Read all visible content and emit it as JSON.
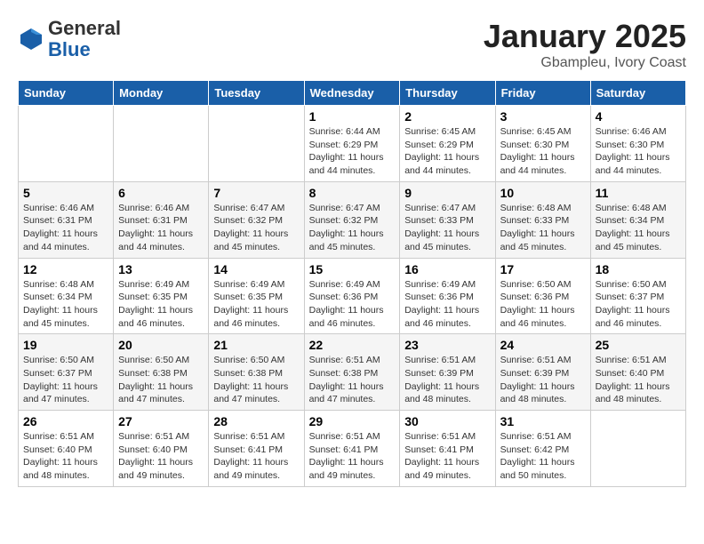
{
  "header": {
    "logo_line1": "General",
    "logo_line2": "Blue",
    "month_title": "January 2025",
    "location": "Gbampleu, Ivory Coast"
  },
  "weekdays": [
    "Sunday",
    "Monday",
    "Tuesday",
    "Wednesday",
    "Thursday",
    "Friday",
    "Saturday"
  ],
  "weeks": [
    [
      {
        "day": "",
        "info": ""
      },
      {
        "day": "",
        "info": ""
      },
      {
        "day": "",
        "info": ""
      },
      {
        "day": "1",
        "info": "Sunrise: 6:44 AM\nSunset: 6:29 PM\nDaylight: 11 hours\nand 44 minutes."
      },
      {
        "day": "2",
        "info": "Sunrise: 6:45 AM\nSunset: 6:29 PM\nDaylight: 11 hours\nand 44 minutes."
      },
      {
        "day": "3",
        "info": "Sunrise: 6:45 AM\nSunset: 6:30 PM\nDaylight: 11 hours\nand 44 minutes."
      },
      {
        "day": "4",
        "info": "Sunrise: 6:46 AM\nSunset: 6:30 PM\nDaylight: 11 hours\nand 44 minutes."
      }
    ],
    [
      {
        "day": "5",
        "info": "Sunrise: 6:46 AM\nSunset: 6:31 PM\nDaylight: 11 hours\nand 44 minutes."
      },
      {
        "day": "6",
        "info": "Sunrise: 6:46 AM\nSunset: 6:31 PM\nDaylight: 11 hours\nand 44 minutes."
      },
      {
        "day": "7",
        "info": "Sunrise: 6:47 AM\nSunset: 6:32 PM\nDaylight: 11 hours\nand 45 minutes."
      },
      {
        "day": "8",
        "info": "Sunrise: 6:47 AM\nSunset: 6:32 PM\nDaylight: 11 hours\nand 45 minutes."
      },
      {
        "day": "9",
        "info": "Sunrise: 6:47 AM\nSunset: 6:33 PM\nDaylight: 11 hours\nand 45 minutes."
      },
      {
        "day": "10",
        "info": "Sunrise: 6:48 AM\nSunset: 6:33 PM\nDaylight: 11 hours\nand 45 minutes."
      },
      {
        "day": "11",
        "info": "Sunrise: 6:48 AM\nSunset: 6:34 PM\nDaylight: 11 hours\nand 45 minutes."
      }
    ],
    [
      {
        "day": "12",
        "info": "Sunrise: 6:48 AM\nSunset: 6:34 PM\nDaylight: 11 hours\nand 45 minutes."
      },
      {
        "day": "13",
        "info": "Sunrise: 6:49 AM\nSunset: 6:35 PM\nDaylight: 11 hours\nand 46 minutes."
      },
      {
        "day": "14",
        "info": "Sunrise: 6:49 AM\nSunset: 6:35 PM\nDaylight: 11 hours\nand 46 minutes."
      },
      {
        "day": "15",
        "info": "Sunrise: 6:49 AM\nSunset: 6:36 PM\nDaylight: 11 hours\nand 46 minutes."
      },
      {
        "day": "16",
        "info": "Sunrise: 6:49 AM\nSunset: 6:36 PM\nDaylight: 11 hours\nand 46 minutes."
      },
      {
        "day": "17",
        "info": "Sunrise: 6:50 AM\nSunset: 6:36 PM\nDaylight: 11 hours\nand 46 minutes."
      },
      {
        "day": "18",
        "info": "Sunrise: 6:50 AM\nSunset: 6:37 PM\nDaylight: 11 hours\nand 46 minutes."
      }
    ],
    [
      {
        "day": "19",
        "info": "Sunrise: 6:50 AM\nSunset: 6:37 PM\nDaylight: 11 hours\nand 47 minutes."
      },
      {
        "day": "20",
        "info": "Sunrise: 6:50 AM\nSunset: 6:38 PM\nDaylight: 11 hours\nand 47 minutes."
      },
      {
        "day": "21",
        "info": "Sunrise: 6:50 AM\nSunset: 6:38 PM\nDaylight: 11 hours\nand 47 minutes."
      },
      {
        "day": "22",
        "info": "Sunrise: 6:51 AM\nSunset: 6:38 PM\nDaylight: 11 hours\nand 47 minutes."
      },
      {
        "day": "23",
        "info": "Sunrise: 6:51 AM\nSunset: 6:39 PM\nDaylight: 11 hours\nand 48 minutes."
      },
      {
        "day": "24",
        "info": "Sunrise: 6:51 AM\nSunset: 6:39 PM\nDaylight: 11 hours\nand 48 minutes."
      },
      {
        "day": "25",
        "info": "Sunrise: 6:51 AM\nSunset: 6:40 PM\nDaylight: 11 hours\nand 48 minutes."
      }
    ],
    [
      {
        "day": "26",
        "info": "Sunrise: 6:51 AM\nSunset: 6:40 PM\nDaylight: 11 hours\nand 48 minutes."
      },
      {
        "day": "27",
        "info": "Sunrise: 6:51 AM\nSunset: 6:40 PM\nDaylight: 11 hours\nand 49 minutes."
      },
      {
        "day": "28",
        "info": "Sunrise: 6:51 AM\nSunset: 6:41 PM\nDaylight: 11 hours\nand 49 minutes."
      },
      {
        "day": "29",
        "info": "Sunrise: 6:51 AM\nSunset: 6:41 PM\nDaylight: 11 hours\nand 49 minutes."
      },
      {
        "day": "30",
        "info": "Sunrise: 6:51 AM\nSunset: 6:41 PM\nDaylight: 11 hours\nand 49 minutes."
      },
      {
        "day": "31",
        "info": "Sunrise: 6:51 AM\nSunset: 6:42 PM\nDaylight: 11 hours\nand 50 minutes."
      },
      {
        "day": "",
        "info": ""
      }
    ]
  ]
}
